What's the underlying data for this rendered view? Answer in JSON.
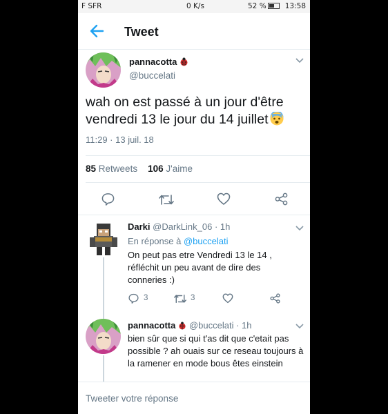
{
  "status_bar": {
    "carrier": "F SFR",
    "speed": "0 K/s",
    "battery": "52 %",
    "time": "13:58"
  },
  "header": {
    "title": "Tweet"
  },
  "main_tweet": {
    "name": "pannacotta",
    "handle": "@buccelati",
    "text": "wah on est passé à un jour d'être vendredi 13 le jour du 14 juillet",
    "timestamp": "11:29 · 13 juil. 18",
    "retweets_count": "85",
    "retweets_label": "Retweets",
    "likes_count": "106",
    "likes_label": "J'aime"
  },
  "replies": [
    {
      "name": "Darki",
      "handle_time": "@DarkLink_06 · 1h",
      "in_reply_prefix": "En réponse à ",
      "in_reply_handle": "@buccelati",
      "text": "On peut pas etre Vendredi 13 le 14 , réfléchit un peu avant de dire des conneries :)",
      "reply_count": "3",
      "retweet_count": "3"
    },
    {
      "name": "pannacotta",
      "handle_time": "@buccelati · 1h",
      "text": "bien sûr que si qui t'as dit que c'etait pas possible ? ah ouais sur ce reseau toujours à la ramener en mode bous êtes einstein"
    }
  ],
  "composer": {
    "placeholder": "Tweeter votre réponse"
  },
  "colors": {
    "accent": "#1da1f2",
    "muted": "#657786",
    "text": "#14171a"
  }
}
